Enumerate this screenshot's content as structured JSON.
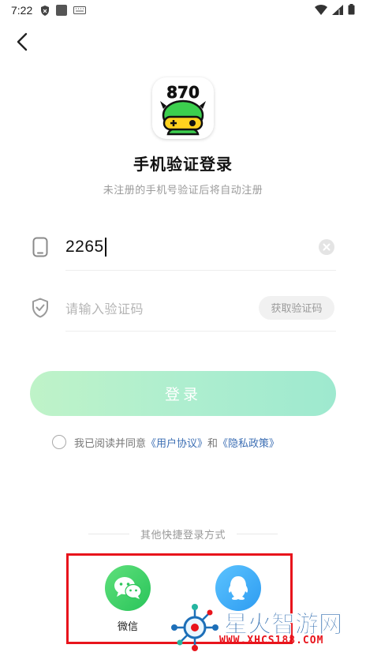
{
  "status_bar": {
    "time": "7:22"
  },
  "header": {
    "back_icon": "chevron-left-icon"
  },
  "logo": {
    "text": "870"
  },
  "title": "手机验证登录",
  "subtitle": "未注册的手机号验证后将自动注册",
  "phone_field": {
    "value": "2265",
    "icon": "phone-icon",
    "clear_icon": "clear-circle-icon"
  },
  "code_field": {
    "placeholder": "请输入验证码",
    "icon": "shield-icon",
    "get_code_label": "获取验证码"
  },
  "login_button": {
    "label": "登录"
  },
  "agreement": {
    "prefix": "我已阅读并同意",
    "user_agreement": "《用户协议》",
    "conjunction": "和",
    "privacy_policy": "《隐私政策》"
  },
  "other_login": {
    "label": "其他快捷登录方式",
    "wechat_label": "微信"
  },
  "watermark": {
    "name": "星火智游网",
    "url": "WWW.XHCS188.COM"
  },
  "colors": {
    "accent_green": "#9ee9cf",
    "link": "#3d6fb4",
    "highlight_red": "#e8141c",
    "wechat_green": "#29c45a",
    "qq_blue": "#2e9cf1"
  }
}
